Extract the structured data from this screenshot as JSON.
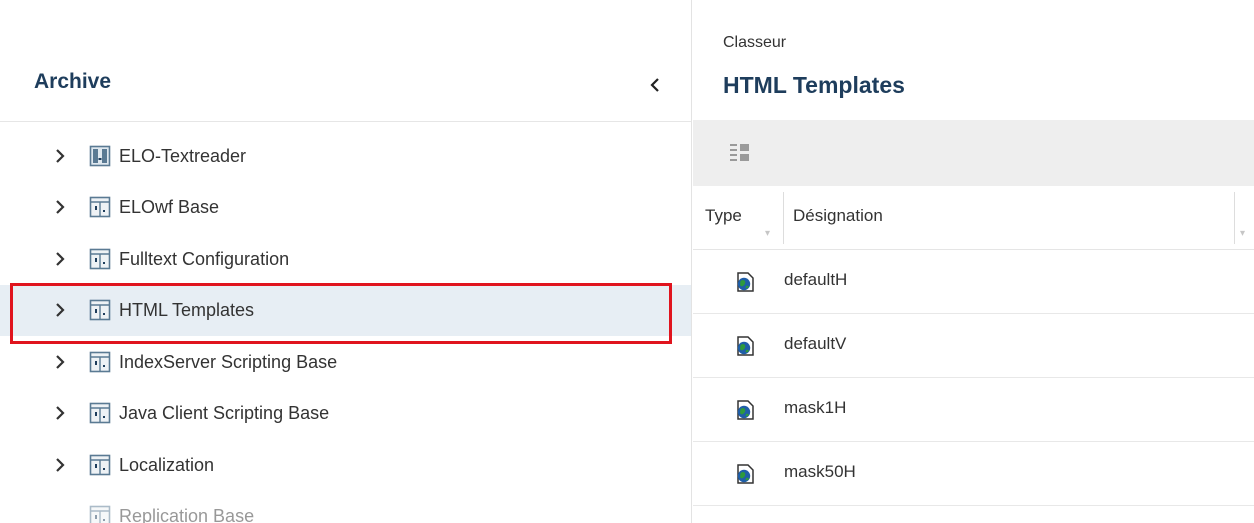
{
  "left_panel": {
    "title": "Archive",
    "tree": [
      {
        "label": "ELO-Textreader",
        "icon": "special-folder-icon",
        "expandable": true,
        "selected": false
      },
      {
        "label": "ELOwf Base",
        "icon": "cabinet-icon",
        "expandable": true,
        "selected": false
      },
      {
        "label": "Fulltext Configuration",
        "icon": "cabinet-icon",
        "expandable": true,
        "selected": false
      },
      {
        "label": "HTML Templates",
        "icon": "cabinet-icon",
        "expandable": true,
        "selected": true
      },
      {
        "label": "IndexServer Scripting Base",
        "icon": "cabinet-icon",
        "expandable": true,
        "selected": false
      },
      {
        "label": "Java Client Scripting Base",
        "icon": "cabinet-icon",
        "expandable": true,
        "selected": false
      },
      {
        "label": "Localization",
        "icon": "cabinet-icon",
        "expandable": true,
        "selected": false
      },
      {
        "label": "Replication Base",
        "icon": "cabinet-icon",
        "expandable": false,
        "selected": false
      }
    ]
  },
  "right_panel": {
    "breadcrumb": "Classeur",
    "title": "HTML Templates",
    "columns": {
      "type": "Type",
      "name": "Désignation"
    },
    "rows": [
      {
        "name": "defaultH",
        "icon": "html-document-icon"
      },
      {
        "name": "defaultV",
        "icon": "html-document-icon"
      },
      {
        "name": "mask1H",
        "icon": "html-document-icon"
      },
      {
        "name": "mask50H",
        "icon": "html-document-icon"
      }
    ]
  },
  "colors": {
    "accent": "#1e3d5c",
    "selection_bg": "#e7eef4",
    "highlight_border": "#e0141e",
    "toolbar_bg": "#eeeeee",
    "cabinet_icon": "#5a7a93"
  }
}
